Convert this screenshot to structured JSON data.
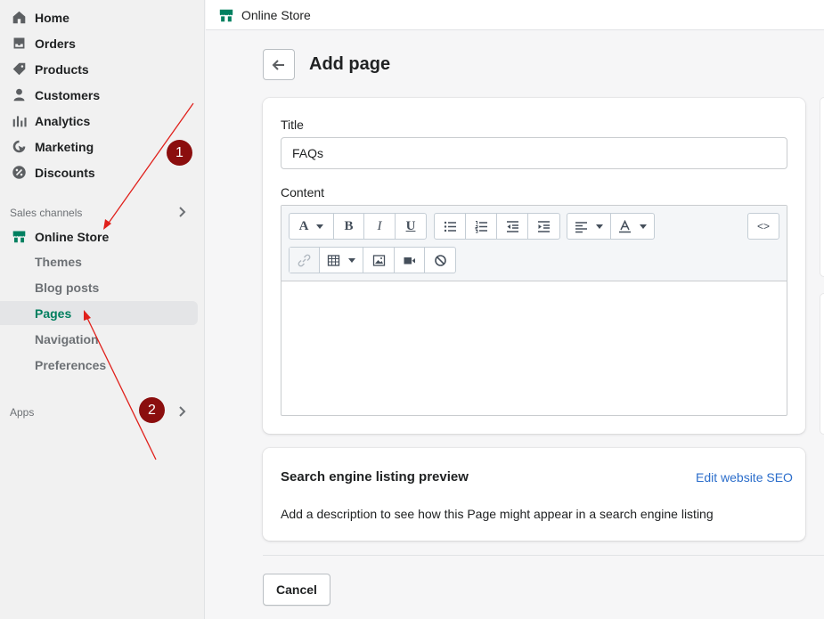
{
  "sidebar": {
    "main_items": [
      {
        "label": "Home",
        "icon": "home-icon"
      },
      {
        "label": "Orders",
        "icon": "orders-icon"
      },
      {
        "label": "Products",
        "icon": "tag-icon"
      },
      {
        "label": "Customers",
        "icon": "person-icon"
      },
      {
        "label": "Analytics",
        "icon": "bar-chart-icon"
      },
      {
        "label": "Marketing",
        "icon": "marketing-icon"
      },
      {
        "label": "Discounts",
        "icon": "discount-icon"
      }
    ],
    "sales_channels_label": "Sales channels",
    "online_store_label": "Online Store",
    "sub_items": [
      "Themes",
      "Blog posts",
      "Pages",
      "Navigation",
      "Preferences"
    ],
    "active_sub_item": "Pages",
    "apps_label": "Apps"
  },
  "topbar": {
    "title": "Online Store"
  },
  "page": {
    "title": "Add page",
    "title_label": "Title",
    "title_value": "FAQs",
    "content_label": "Content",
    "toolbar": {
      "font_label": "A",
      "bold_label": "B",
      "italic_label": "I",
      "underline_label": "U",
      "code_label": "<>"
    }
  },
  "seo": {
    "heading": "Search engine listing preview",
    "edit_link": "Edit website SEO",
    "description": "Add a description to see how this Page might appear in a search engine listing"
  },
  "actions": {
    "cancel_label": "Cancel"
  },
  "annotations": {
    "badge_1": "1",
    "badge_2": "2"
  },
  "colors": {
    "brand": "#008060",
    "active_text": "#007f5f",
    "link": "#2c6ecb",
    "annotation": "#8b0e0e",
    "arrow": "#e0201b"
  }
}
